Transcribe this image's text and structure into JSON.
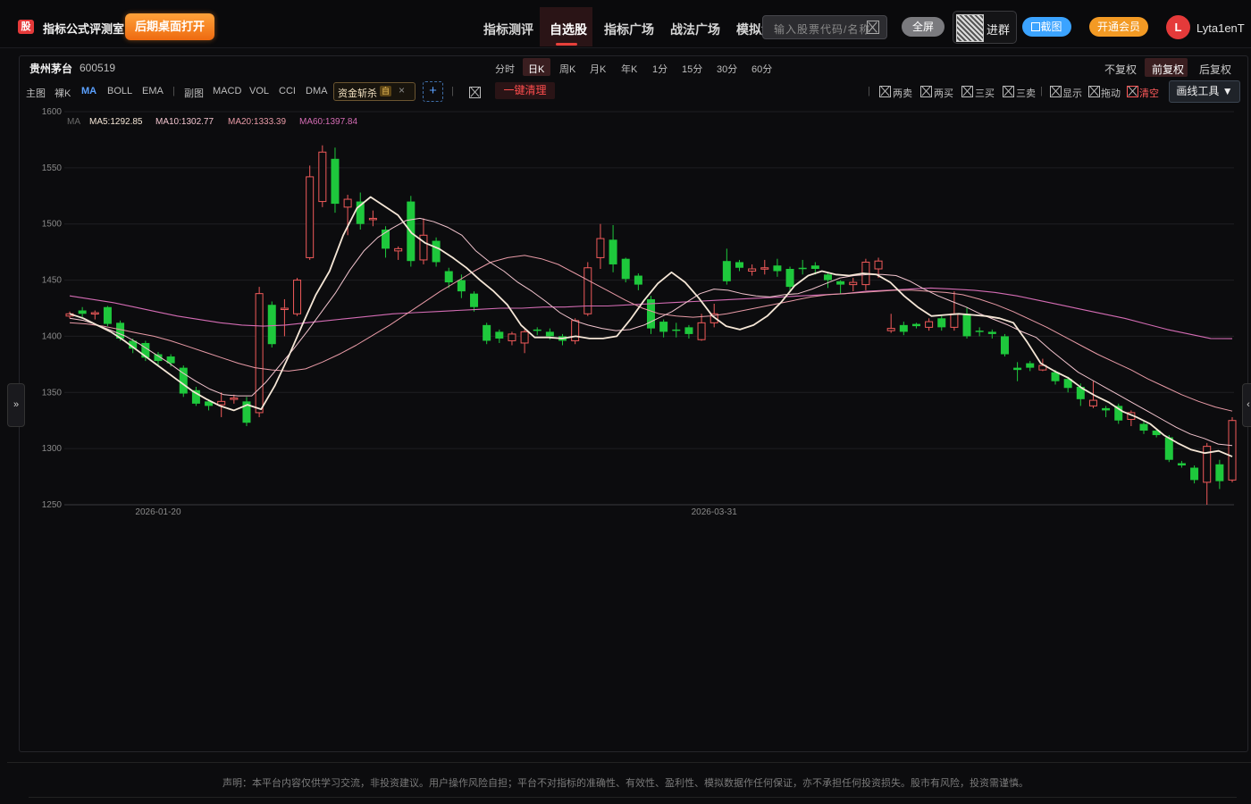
{
  "header": {
    "logo_char": "股",
    "app_title": "指标公式评测室",
    "desktop_button": "后期桌面打开",
    "nav": [
      "指标测评",
      "自选股",
      "指标广场",
      "战法广场",
      "模拟盘"
    ],
    "nav_active_index": 1,
    "search_placeholder": "输入股票代码/名称",
    "fullscreen_button": "全屏",
    "group_label": "进群",
    "screenshot_button": "截图",
    "vip_button": "开通会员",
    "avatar_letter": "L",
    "username": "Lyta1enT"
  },
  "stock": {
    "name": "贵州茅台",
    "code": "600519"
  },
  "periods": [
    "分时",
    "日K",
    "周K",
    "月K",
    "年K",
    "1分",
    "15分",
    "30分",
    "60分"
  ],
  "period_active_index": 1,
  "adjust": [
    "不复权",
    "前复权",
    "后复权"
  ],
  "adjust_active_index": 1,
  "toolbar": {
    "main_label": "主图",
    "main_items": [
      "裸K",
      "MA",
      "BOLL",
      "EMA"
    ],
    "main_active_index": 1,
    "sub_label": "副图",
    "sub_items": [
      "MACD",
      "VOL",
      "CCI",
      "DMA"
    ],
    "indicator_tag": "资金斩杀",
    "indicator_badge": "自",
    "clear_button": "一键清理",
    "signals": [
      "两卖",
      "两买",
      "三买",
      "三卖",
      "显示",
      "拖动",
      "清空"
    ],
    "draw_tools": "画线工具 ▼"
  },
  "colors": {
    "up": "#f05a5a",
    "down": "#1ec83c",
    "ma5": "#f5e6d6",
    "ma10": "#f2c4ce",
    "ma20": "#e89aa6",
    "ma60": "#d46cb4",
    "accent_red": "#e8403a",
    "accent_blue": "#3ba3ff",
    "accent_orange": "#f39a24"
  },
  "chart_data": {
    "type": "candlestick",
    "ylim": [
      1250,
      1600
    ],
    "yticks": [
      1600,
      1550,
      1500,
      1450,
      1400,
      1350,
      1300,
      1250
    ],
    "x_labels": [
      {
        "index": 7,
        "label": "2026-01-20"
      },
      {
        "index": 51,
        "label": "2026-03-31"
      }
    ],
    "ma_legend": {
      "prefix": "MA",
      "items": [
        "MA5:1292.85",
        "MA10:1302.77",
        "MA20:1333.39",
        "MA60:1397.84"
      ]
    },
    "candles": [
      [
        1418,
        1420,
        1416,
        1422
      ],
      [
        1423,
        1420,
        1417,
        1426
      ],
      [
        1420,
        1421,
        1415,
        1423
      ],
      [
        1426,
        1411,
        1409,
        1427
      ],
      [
        1412,
        1398,
        1396,
        1414
      ],
      [
        1396,
        1389,
        1385,
        1398
      ],
      [
        1394,
        1381,
        1378,
        1396
      ],
      [
        1384,
        1378,
        1374,
        1386
      ],
      [
        1382,
        1376,
        1373,
        1384
      ],
      [
        1372,
        1349,
        1346,
        1374
      ],
      [
        1352,
        1340,
        1338,
        1355
      ],
      [
        1342,
        1338,
        1334,
        1344
      ],
      [
        1339,
        1342,
        1328,
        1350
      ],
      [
        1344,
        1345,
        1340,
        1348
      ],
      [
        1342,
        1323,
        1320,
        1346
      ],
      [
        1332,
        1438,
        1328,
        1444
      ],
      [
        1428,
        1393,
        1390,
        1431
      ],
      [
        1424,
        1425,
        1400,
        1433
      ],
      [
        1420,
        1450,
        1418,
        1452
      ],
      [
        1470,
        1542,
        1468,
        1552
      ],
      [
        1520,
        1564,
        1515,
        1570
      ],
      [
        1558,
        1518,
        1510,
        1568
      ],
      [
        1515,
        1522,
        1490,
        1526
      ],
      [
        1520,
        1500,
        1495,
        1528
      ],
      [
        1505,
        1505,
        1498,
        1512
      ],
      [
        1495,
        1478,
        1470,
        1498
      ],
      [
        1476,
        1478,
        1468,
        1480
      ],
      [
        1520,
        1467,
        1462,
        1525
      ],
      [
        1468,
        1490,
        1464,
        1505
      ],
      [
        1485,
        1466,
        1462,
        1488
      ],
      [
        1458,
        1448,
        1443,
        1461
      ],
      [
        1450,
        1440,
        1434,
        1455
      ],
      [
        1438,
        1426,
        1422,
        1440
      ],
      [
        1410,
        1396,
        1393,
        1412
      ],
      [
        1404,
        1398,
        1394,
        1406
      ],
      [
        1396,
        1402,
        1392,
        1404
      ],
      [
        1394,
        1404,
        1385,
        1406
      ],
      [
        1406,
        1405,
        1401,
        1408
      ],
      [
        1404,
        1400,
        1397,
        1407
      ],
      [
        1400,
        1396,
        1392,
        1402
      ],
      [
        1396,
        1414,
        1393,
        1416
      ],
      [
        1420,
        1461,
        1418,
        1466
      ],
      [
        1470,
        1487,
        1460,
        1500
      ],
      [
        1486,
        1464,
        1457,
        1499
      ],
      [
        1469,
        1451,
        1448,
        1470
      ],
      [
        1454,
        1446,
        1441,
        1456
      ],
      [
        1433,
        1407,
        1402,
        1436
      ],
      [
        1413,
        1404,
        1399,
        1415
      ],
      [
        1406,
        1405,
        1399,
        1412
      ],
      [
        1408,
        1402,
        1398,
        1410
      ],
      [
        1397,
        1412,
        1396,
        1420
      ],
      [
        1412,
        1420,
        1408,
        1429
      ],
      [
        1467,
        1449,
        1446,
        1478
      ],
      [
        1466,
        1461,
        1458,
        1468
      ],
      [
        1458,
        1460,
        1454,
        1464
      ],
      [
        1460,
        1461,
        1455,
        1468
      ],
      [
        1463,
        1458,
        1453,
        1469
      ],
      [
        1460,
        1444,
        1440,
        1462
      ],
      [
        1461,
        1460,
        1455,
        1468
      ],
      [
        1463,
        1460,
        1455,
        1466
      ],
      [
        1455,
        1450,
        1443,
        1457
      ],
      [
        1449,
        1446,
        1438,
        1450
      ],
      [
        1446,
        1448,
        1440,
        1452
      ],
      [
        1446,
        1466,
        1441,
        1469
      ],
      [
        1460,
        1467,
        1452,
        1470
      ],
      [
        1405,
        1407,
        1403,
        1420
      ],
      [
        1410,
        1404,
        1401,
        1413
      ],
      [
        1411,
        1409,
        1407,
        1412
      ],
      [
        1408,
        1413,
        1405,
        1416
      ],
      [
        1416,
        1408,
        1405,
        1418
      ],
      [
        1408,
        1420,
        1405,
        1440
      ],
      [
        1420,
        1400,
        1398,
        1426
      ],
      [
        1405,
        1404,
        1400,
        1408
      ],
      [
        1404,
        1402,
        1398,
        1406
      ],
      [
        1400,
        1384,
        1382,
        1402
      ],
      [
        1372,
        1370,
        1360,
        1377
      ],
      [
        1376,
        1372,
        1369,
        1378
      ],
      [
        1370,
        1374,
        1369,
        1380
      ],
      [
        1368,
        1360,
        1357,
        1370
      ],
      [
        1362,
        1354,
        1350,
        1364
      ],
      [
        1355,
        1344,
        1338,
        1358
      ],
      [
        1338,
        1343,
        1336,
        1360
      ],
      [
        1336,
        1334,
        1328,
        1338
      ],
      [
        1338,
        1325,
        1322,
        1340
      ],
      [
        1326,
        1332,
        1320,
        1334
      ],
      [
        1322,
        1316,
        1313,
        1325
      ],
      [
        1316,
        1312,
        1310,
        1318
      ],
      [
        1310,
        1290,
        1288,
        1312
      ],
      [
        1287,
        1285,
        1283,
        1289
      ],
      [
        1283,
        1272,
        1269,
        1285
      ],
      [
        1270,
        1302,
        1250,
        1305
      ],
      [
        1286,
        1271,
        1264,
        1290
      ],
      [
        1272,
        1325,
        1270,
        1328
      ]
    ],
    "ma5": [
      1420,
      1416,
      1410,
      1404,
      1396,
      1387,
      1378,
      1369,
      1360,
      1351,
      1344,
      1338,
      1334,
      1339,
      1335,
      1356,
      1382,
      1410,
      1437,
      1458,
      1490,
      1514,
      1524,
      1516,
      1508,
      1492,
      1483,
      1478,
      1470,
      1461,
      1450,
      1440,
      1428,
      1410,
      1399,
      1399,
      1398,
      1400,
      1398,
      1398,
      1400,
      1415,
      1432,
      1447,
      1457,
      1448,
      1434,
      1418,
      1409,
      1406,
      1410,
      1418,
      1430,
      1445,
      1454,
      1458,
      1455,
      1454,
      1456,
      1455,
      1448,
      1436,
      1426,
      1418,
      1419,
      1420,
      1419,
      1418,
      1416,
      1412,
      1395,
      1376,
      1369,
      1363,
      1354,
      1347,
      1341,
      1333,
      1328,
      1322,
      1312,
      1305,
      1299,
      1296,
      1298,
      1292.85
    ],
    "ma10": [
      1416,
      1414,
      1410,
      1405,
      1400,
      1393,
      1385,
      1377,
      1368,
      1360,
      1353,
      1348,
      1347,
      1347,
      1359,
      1374,
      1389,
      1405,
      1422,
      1439,
      1459,
      1476,
      1488,
      1496,
      1503,
      1505,
      1502,
      1497,
      1490,
      1476,
      1466,
      1458,
      1448,
      1440,
      1431,
      1421,
      1414,
      1410,
      1407,
      1405,
      1406,
      1410,
      1416,
      1422,
      1430,
      1438,
      1442,
      1441,
      1438,
      1436,
      1435,
      1437,
      1438,
      1442,
      1447,
      1452,
      1454,
      1455,
      1455,
      1454,
      1449,
      1442,
      1436,
      1431,
      1426,
      1420,
      1415,
      1410,
      1404,
      1399,
      1388,
      1378,
      1368,
      1361,
      1354,
      1347,
      1340,
      1333,
      1326,
      1319,
      1313,
      1309,
      1304,
      1302.77
    ],
    "ma20": [
      1412,
      1411,
      1409,
      1406,
      1403,
      1400,
      1396,
      1391,
      1386,
      1381,
      1376,
      1372,
      1370,
      1369,
      1371,
      1377,
      1384,
      1392,
      1401,
      1410,
      1420,
      1430,
      1440,
      1449,
      1458,
      1466,
      1470,
      1472,
      1469,
      1464,
      1456,
      1448,
      1440,
      1432,
      1425,
      1420,
      1418,
      1417,
      1418,
      1420,
      1423,
      1426,
      1429,
      1432,
      1435,
      1437,
      1438,
      1439,
      1440,
      1441,
      1441,
      1440,
      1439,
      1437,
      1433,
      1428,
      1422,
      1415,
      1408,
      1400,
      1392,
      1384,
      1377,
      1370,
      1362,
      1355,
      1348,
      1342,
      1337,
      1333.39
    ],
    "ma60": [
      1436,
      1433,
      1430,
      1426,
      1422,
      1418,
      1415,
      1412,
      1410,
      1409,
      1410,
      1412,
      1414,
      1416,
      1418,
      1420,
      1421,
      1422,
      1423,
      1424,
      1425,
      1425,
      1426,
      1426,
      1427,
      1427,
      1428,
      1429,
      1430,
      1431,
      1432,
      1433,
      1434,
      1435,
      1436,
      1437,
      1438,
      1440,
      1441,
      1442,
      1443,
      1442,
      1441,
      1439,
      1436,
      1432,
      1428,
      1424,
      1420,
      1416,
      1411,
      1406,
      1402,
      1398,
      1397.84
    ]
  },
  "footer": {
    "disclaimer": "声明：本平台内容仅供学习交流，非投资建议。用户操作风险自担；平台不对指标的准确性、有效性、盈利性、模拟数据作任何保证，亦不承担任何投资损失。股市有风险，投资需谨慎。"
  }
}
